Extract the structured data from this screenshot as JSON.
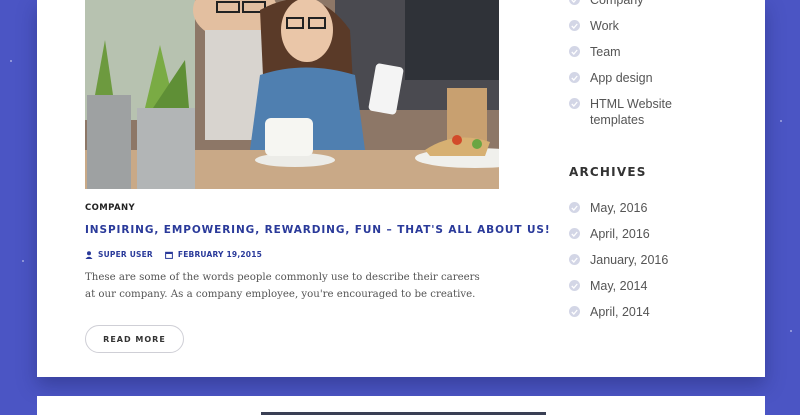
{
  "post": {
    "category": "COMPANY",
    "title": "INSPIRING, EMPOWERING, REWARDING, FUN – THAT'S ALL ABOUT US!",
    "author": "SUPER USER",
    "date": "FEBRUARY 19,2015",
    "excerpt": "These are some of the words people commonly use to describe their careers at our company. As a company employee, you're encouraged to be creative.",
    "read_more_label": "READ MORE"
  },
  "sidebar": {
    "categories": [
      {
        "label": "Company"
      },
      {
        "label": "Work"
      },
      {
        "label": "Team"
      },
      {
        "label": "App design"
      },
      {
        "label": "HTML Website templates"
      }
    ],
    "archives_title": "ARCHIVES",
    "archives": [
      {
        "label": "May, 2016"
      },
      {
        "label": "April, 2016"
      },
      {
        "label": "January, 2016"
      },
      {
        "label": "May, 2014"
      },
      {
        "label": "April, 2014"
      }
    ]
  },
  "colors": {
    "background": "#4b55c4",
    "accent": "#2a3a9a",
    "card": "#ffffff"
  },
  "icons": {
    "author": "user-icon",
    "date": "calendar-icon",
    "list_bullet": "check-circle-icon"
  }
}
